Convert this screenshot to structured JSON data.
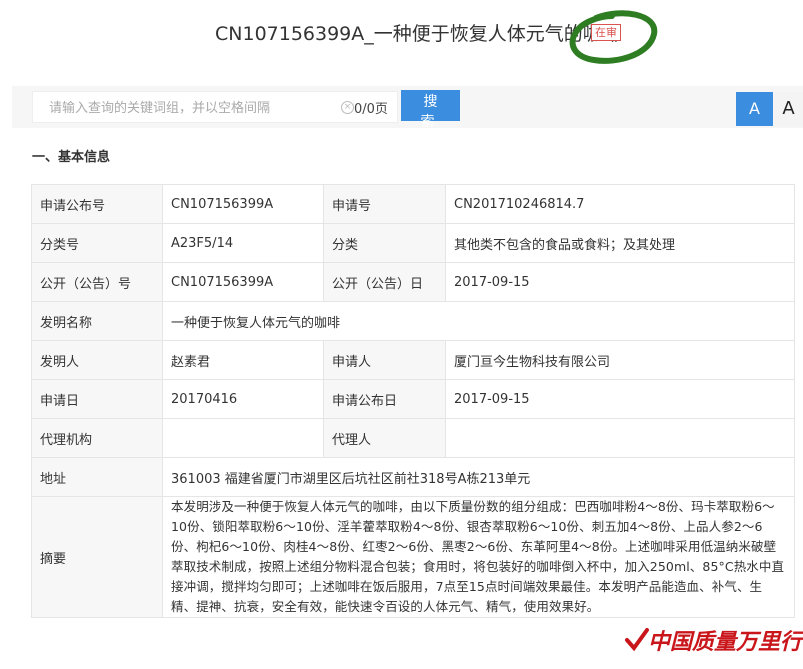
{
  "header": {
    "title": "CN107156399A_一种便于恢复人体元气的咖啡",
    "status": "在审"
  },
  "search": {
    "placeholder": "请输入查询的关键词组，并以空格间隔",
    "page_count": "0/0页",
    "button_label": "搜 索"
  },
  "font_controls": {
    "a_large": "A",
    "a_small": "A"
  },
  "section": {
    "title": "一、基本信息"
  },
  "info": {
    "pub_no_label": "申请公布号",
    "pub_no": "CN107156399A",
    "app_no_label": "申请号",
    "app_no": "CN201710246814.7",
    "class_no_label": "分类号",
    "class_no": "A23F5/14",
    "class_label": "分类",
    "class": "其他类不包含的食品或食料；及其处理",
    "open_no_label": "公开（公告）号",
    "open_no": "CN107156399A",
    "open_date_label": "公开（公告）日",
    "open_date": "2017-09-15",
    "name_label": "发明名称",
    "name": "一种便于恢复人体元气的咖啡",
    "inventor_label": "发明人",
    "inventor": "赵素君",
    "applicant_label": "申请人",
    "applicant": "厦门亘今生物科技有限公司",
    "app_date_label": "申请日",
    "app_date": "20170416",
    "app_pub_date_label": "申请公布日",
    "app_pub_date": "2017-09-15",
    "agency_label": "代理机构",
    "agency": "",
    "agent_label": "代理人",
    "agent": "",
    "address_label": "地址",
    "address": "361003 福建省厦门市湖里区后坑社区前社318号A栋213单元",
    "abstract_label": "摘要",
    "abstract": "本发明涉及一种便于恢复人体元气的咖啡，由以下质量份数的组分组成：巴西咖啡粉4～8份、玛卡萃取粉6～10份、锁阳萃取粉6～10份、淫羊藿萃取粉4～8份、银杏萃取粉6～10份、刺五加4～8份、上品人参2～6份、枸杞6～10份、肉桂4～8份、红枣2～6份、黑枣2～6份、东革阿里4～8份。上述咖啡采用低温纳米破壁萃取技术制成，按照上述组分物料混合包装；食用时，将包装好的咖啡倒入杯中，加入250ml、85°C热水中直接冲调，搅拌均匀即可；上述咖啡在饭后服用，7点至15点时间端效果最佳。本发明产品能造血、补气、生精、提神、抗衰，安全有效，能快速令百设的人体元气、精气，使用效果好。"
  },
  "watermark": {
    "text": "中国质量万里行"
  },
  "colors": {
    "accent": "#3b8de0",
    "status": "#d9534f",
    "link": "#2a6fbd",
    "watermark": "#c9161b",
    "marker": "#2e7d22"
  }
}
